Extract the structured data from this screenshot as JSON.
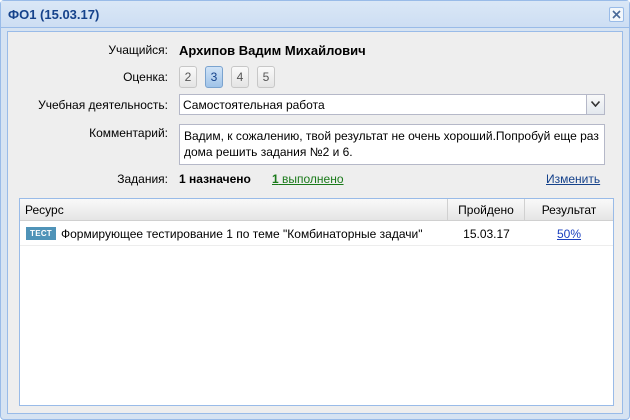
{
  "window": {
    "title": "ФО1 (15.03.17)"
  },
  "form": {
    "student_label": "Учащийся:",
    "student_name": "Архипов Вадим Михайлович",
    "grade_label": "Оценка:",
    "grades": [
      "2",
      "3",
      "4",
      "5"
    ],
    "selected_grade": "3",
    "activity_label": "Учебная деятельность:",
    "activity_value": "Самостоятельная работа",
    "comment_label": "Комментарий:",
    "comment_text": "Вадим, к сожалению, твой результат не очень хороший.Попробуй еще раз дома решить задания №2 и 6.",
    "assignments_label": "Задания:",
    "assignments_assigned": "1 назначено",
    "assignments_done_count": "1",
    "assignments_done_text": " выполнено",
    "change_label": "Изменить"
  },
  "grid": {
    "columns": [
      "Ресурс",
      "Пройдено",
      "Результат"
    ],
    "rows": [
      {
        "badge": "ТЕСТ",
        "resource": "Формирующее тестирование 1 по теме \"Комбинаторные задачи\"",
        "passed": "15.03.17",
        "result": "50%"
      }
    ]
  },
  "colors": {
    "title": "#15428b",
    "window_border": "#99bbe8",
    "badge": "#4f93b8",
    "done_link": "#1a7a1a",
    "result_link": "#1a3fbf"
  },
  "icons": {
    "close": "close-icon",
    "dropdown": "chevron-down-icon"
  }
}
